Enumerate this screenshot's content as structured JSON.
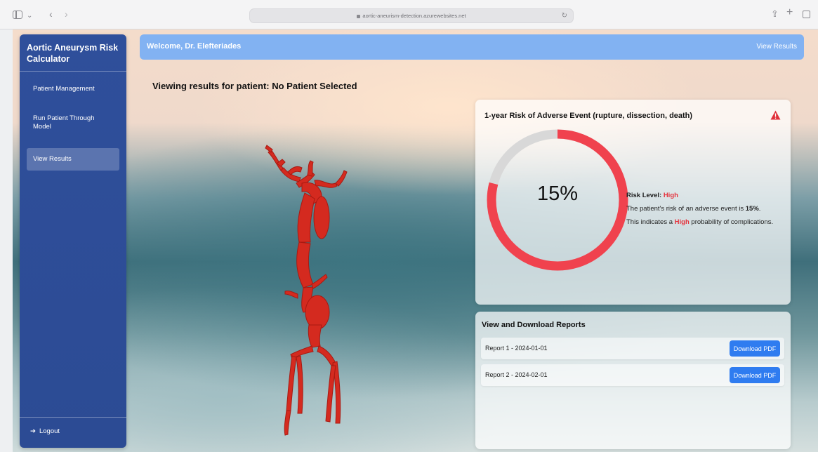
{
  "browser": {
    "url": "aortic-aneurism-detection.azurewebsites.net"
  },
  "sidebar": {
    "brand": "Aortic Aneurysm Risk Calculator",
    "items": [
      {
        "label": "Patient Management"
      },
      {
        "label": "Run Patient Through Model"
      },
      {
        "label": "View Results"
      }
    ],
    "logout_label": "Logout",
    "logout_icon": "arrow-right-icon"
  },
  "header": {
    "welcome": "Welcome, Dr. Elefteriades",
    "view_results_label": "View Results",
    "color": "#82b2f2"
  },
  "main": {
    "patient_title": "Viewing results for patient: No Patient Selected"
  },
  "risk": {
    "title": "1-year Risk of Adverse Event (rupture, dissection, death)",
    "warning_icon": "warning-triangle-icon",
    "value_percent": 15,
    "display": "15%",
    "ring_fill_fraction": 0.79,
    "level_label": "Risk Level:",
    "level": "High",
    "sentence1_prefix": "The patient's risk of an adverse event is",
    "sentence1_value": "15%",
    "sentence1_suffix": ".",
    "sentence2_prefix": "This indicates a",
    "sentence2_level": "High",
    "sentence2_suffix": "probability of complications.",
    "accent_color": "#f0424e",
    "track_color": "#d8d8d8"
  },
  "reports": {
    "title": "View and Download Reports",
    "items": [
      {
        "name": "Report 1 - 2024-01-01",
        "button": "Download PDF"
      },
      {
        "name": "Report 2 - 2024-02-01",
        "button": "Download PDF"
      }
    ],
    "button_color": "#2f7cf0"
  }
}
